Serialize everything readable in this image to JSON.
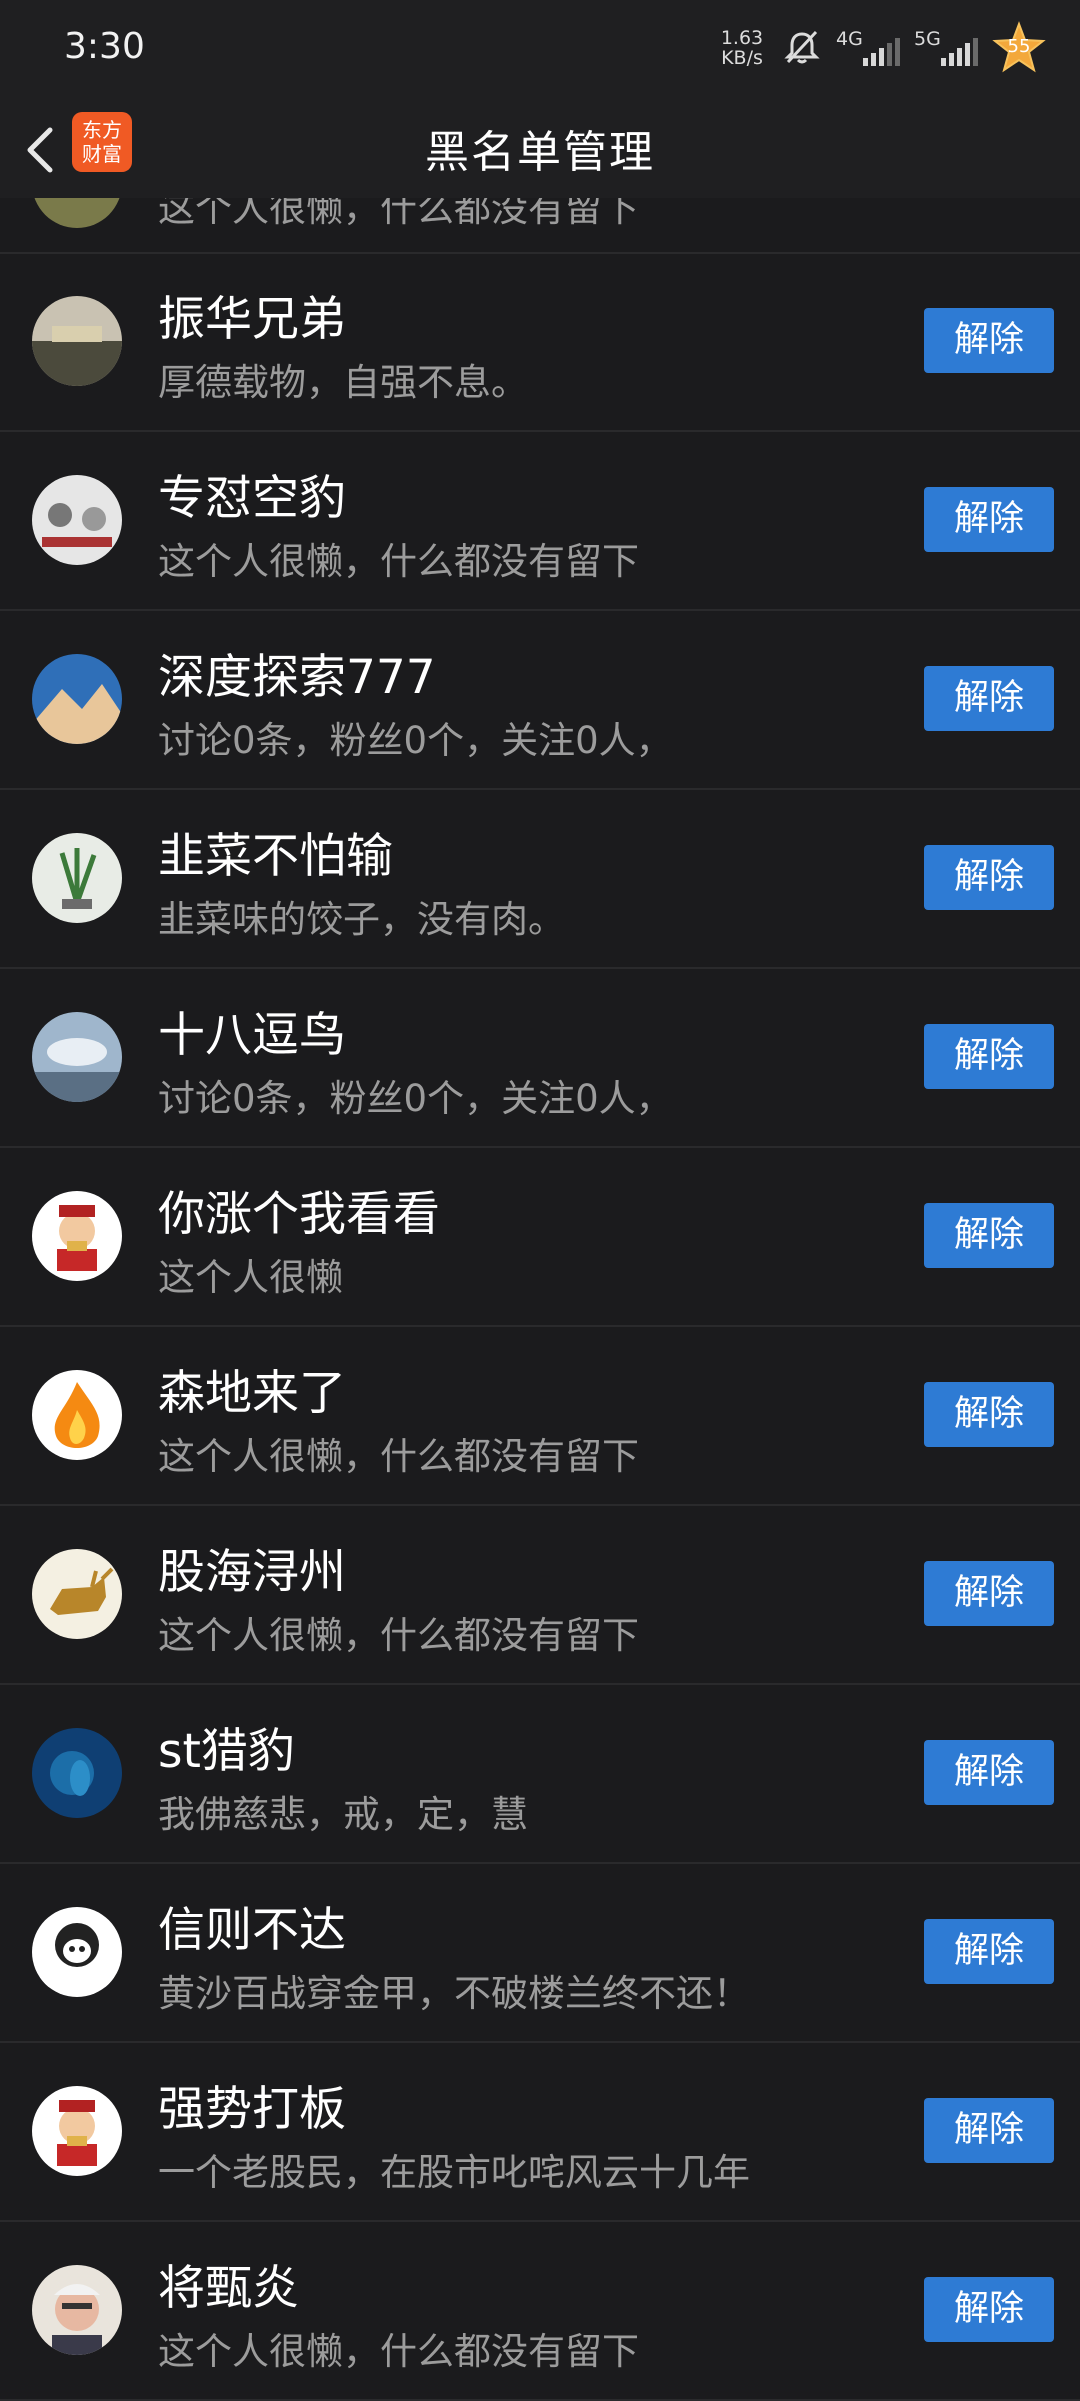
{
  "status": {
    "time": "3:30",
    "speed_value": "1.63",
    "speed_unit": "KB/s",
    "net1": "4G",
    "net2": "5G",
    "battery": "55"
  },
  "header": {
    "title": "黑名单管理",
    "brand_line1": "东方",
    "brand_line2": "财富"
  },
  "partial_row": {
    "desc": "这个人很懒，什么都没有留下"
  },
  "action_label": "解除",
  "rows": [
    {
      "name": "振华兄弟",
      "desc": "厚德载物，自强不息。"
    },
    {
      "name": "专怼空豹",
      "desc": "这个人很懒，什么都没有留下"
    },
    {
      "name": "深度探索777",
      "desc": "讨论0条，粉丝0个，关注0人，"
    },
    {
      "name": "韭菜不怕输",
      "desc": "韭菜味的饺子，没有肉。"
    },
    {
      "name": "十八逗鸟",
      "desc": "讨论0条，粉丝0个，关注0人，"
    },
    {
      "name": "你涨个我看看",
      "desc": "这个人很懒"
    },
    {
      "name": "森地来了",
      "desc": "这个人很懒，什么都没有留下"
    },
    {
      "name": "股海浔州",
      "desc": "这个人很懒，什么都没有留下"
    },
    {
      "name": "st猎豹",
      "desc": "我佛慈悲，戒，定，慧"
    },
    {
      "name": "信则不达",
      "desc": "黄沙百战穿金甲，不破楼兰终不还！"
    },
    {
      "name": "强势打板",
      "desc": "一个老股民，在股市叱咤风云十几年"
    },
    {
      "name": "将甄炎",
      "desc": "这个人很懒，什么都没有留下"
    }
  ],
  "avatar_icons": [
    "landscape-avatar-icon",
    "cartoon-avatar-icon",
    "mountain-avatar-icon",
    "plant-avatar-icon",
    "sky-avatar-icon",
    "fortune-god-avatar-icon",
    "fire-avatar-icon",
    "bull-avatar-icon",
    "ocean-avatar-icon",
    "meme-avatar-icon",
    "fortune-god-avatar-icon",
    "portrait-avatar-icon"
  ],
  "colors": {
    "background": "#1b1b1d",
    "button": "#2e7bd4",
    "brand": "#f05a24",
    "secondary_text": "#9c9c9c"
  }
}
